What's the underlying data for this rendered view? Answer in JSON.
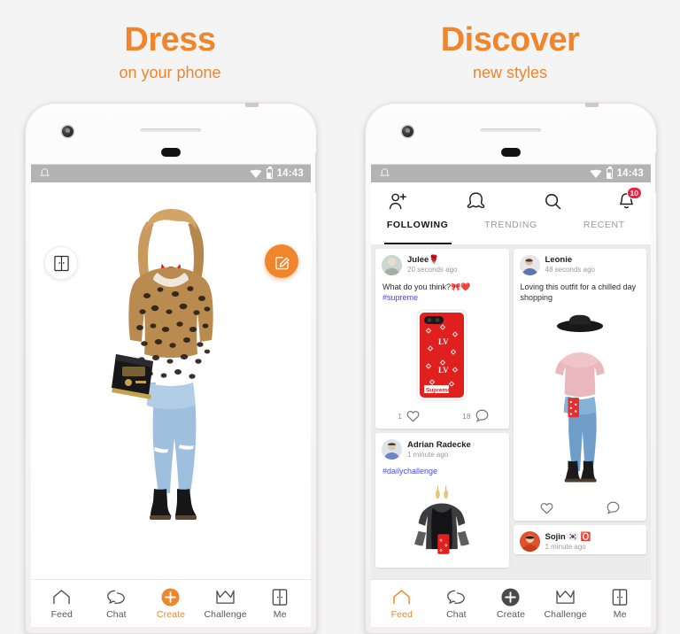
{
  "panels": [
    {
      "headline": "Dress",
      "subhead": "on your phone",
      "statusbar": {
        "time": "14:43",
        "app_icon": "ghost-icon",
        "wifi_icon": "wifi-icon",
        "battery_icon": "battery-icon"
      },
      "fab_left": {
        "icon": "wardrobe-icon",
        "name": "wardrobe-button"
      },
      "fab_right": {
        "icon": "edit-note-icon",
        "name": "edit-outfit-button"
      },
      "outfit": {
        "description": "styled avatar wearing leopard print coat, red scarf, black shoulder bag, ripped light blue jeans and black lace-up boots"
      },
      "nav": [
        {
          "label": "Feed",
          "icon": "home-icon",
          "active": false
        },
        {
          "label": "Chat",
          "icon": "chat-bubbles-icon",
          "active": false
        },
        {
          "label": "Create",
          "icon": "plus-circle-icon",
          "active": true
        },
        {
          "label": "Challenge",
          "icon": "crown-icon",
          "active": false
        },
        {
          "label": "Me",
          "icon": "wardrobe-icon",
          "active": false
        }
      ]
    },
    {
      "headline": "Discover",
      "subhead": "new styles",
      "statusbar": {
        "time": "14:43",
        "app_icon": "ghost-icon",
        "wifi_icon": "wifi-icon",
        "battery_icon": "battery-icon"
      },
      "topbar": {
        "add_friend_icon": "add-person-icon",
        "logo_icon": "ghost-logo-icon",
        "search_icon": "search-icon",
        "bell_icon": "bell-icon",
        "bell_badge": "10"
      },
      "tabs": [
        {
          "label": "FOLLOWING",
          "active": true
        },
        {
          "label": "TRENDING",
          "active": false
        },
        {
          "label": "RECENT",
          "active": false
        }
      ],
      "feed": {
        "left_column": [
          {
            "user": "Julee🌹",
            "time": "20 seconds ago",
            "text": "What do you think?🎀❤️ ",
            "hashtag": "#supreme",
            "media": "red louis vuitton supreme phone case",
            "likes": "1",
            "comments": "18"
          },
          {
            "user": "Adrian Radecke",
            "time": "1 minute ago",
            "text": "",
            "hashtag": "#dailychallenge",
            "media": "black sheer ruffled dress with gold earrings and red phone case",
            "likes": "",
            "comments": ""
          }
        ],
        "right_column": [
          {
            "user": "Leonie",
            "time": "48 seconds ago",
            "text": "Loving this outfit for a chilled day shopping",
            "hashtag": "",
            "media": "black wide brim hat, pink knit sweater, blue jeans with red pouch and black boots",
            "likes": "",
            "comments": ""
          },
          {
            "user": "Sojin 🇰🇷 🅾️",
            "time": "1 minute ago",
            "text": "",
            "hashtag": "",
            "media": "",
            "likes": "",
            "comments": ""
          }
        ]
      },
      "nav": [
        {
          "label": "Feed",
          "icon": "home-icon",
          "active": true
        },
        {
          "label": "Chat",
          "icon": "chat-bubbles-icon",
          "active": false
        },
        {
          "label": "Create",
          "icon": "plus-circle-icon",
          "active": false
        },
        {
          "label": "Challenge",
          "icon": "crown-icon",
          "active": false
        },
        {
          "label": "Me",
          "icon": "wardrobe-icon",
          "active": false
        }
      ]
    }
  ],
  "colors": {
    "accent": "#f0852c",
    "background": "#f4f4f4",
    "badge": "#f31d3f",
    "hashtag": "#4a4ae0",
    "statusbar": "#b3b3b3"
  }
}
